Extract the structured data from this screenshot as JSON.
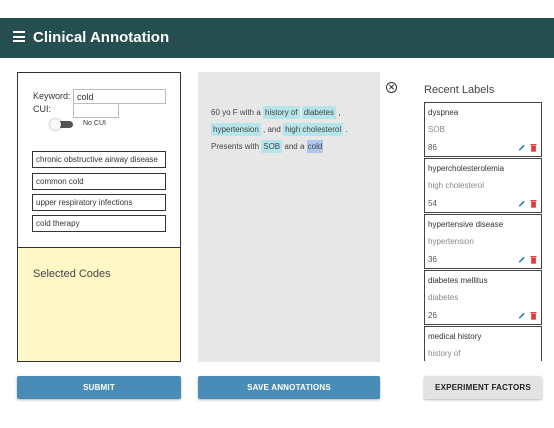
{
  "app": {
    "title": "Clinical Annotation"
  },
  "search": {
    "keyword_label": "Keyword:",
    "keyword_value": "cold",
    "cui_label": "CUI:",
    "cui_value": "",
    "no_cui_label": "No CUI",
    "no_cui_toggle_on": false
  },
  "concepts": [
    "chronic obstructive airway disease",
    "common cold",
    "upper respiratory infections",
    "cold therapy"
  ],
  "selected_codes": {
    "title": "Selected Codes"
  },
  "note": {
    "segments": [
      {
        "text": "60 yo F with a ",
        "highlight": "none"
      },
      {
        "text": "history of",
        "highlight": "label"
      },
      {
        "text": " ",
        "highlight": "none"
      },
      {
        "text": "diabetes",
        "highlight": "label"
      },
      {
        "text": " , ",
        "highlight": "none"
      },
      {
        "text": "hypertension",
        "highlight": "label"
      },
      {
        "text": " , and ",
        "highlight": "none"
      },
      {
        "text": "high cholesterol",
        "highlight": "label"
      },
      {
        "text": " . Presents with ",
        "highlight": "none"
      },
      {
        "text": "SOB",
        "highlight": "label"
      },
      {
        "text": " and a ",
        "highlight": "none"
      },
      {
        "text": "cold",
        "highlight": "selection"
      }
    ]
  },
  "recent_labels": {
    "title": "Recent Labels",
    "items": [
      {
        "name": "dyspnea",
        "text": "SOB",
        "count": "86"
      },
      {
        "name": "hypercholesterolemia",
        "text": "high cholesterol",
        "count": "54"
      },
      {
        "name": "hypertensive disease",
        "text": "hypertension",
        "count": "36"
      },
      {
        "name": "diabetes mellitus",
        "text": "diabetes",
        "count": "26"
      },
      {
        "name": "medical history",
        "text": "history of",
        "count": ""
      }
    ]
  },
  "buttons": {
    "submit": "SUBMIT",
    "save": "SAVE ANNOTATIONS",
    "experiment": "EXPERIMENT FACTORS"
  },
  "colors": {
    "header": "#264d4f",
    "primary_button": "#4a8cb8",
    "label_highlight": "#b5e4ea",
    "selection_highlight": "#aec7ef",
    "selected_codes_bg": "#fdf8c6",
    "edit_icon": "#2f7fae",
    "delete_icon": "#e53935"
  },
  "icons": {
    "menu": "menu-icon",
    "close": "close-circle-icon",
    "edit": "pencil-icon",
    "delete": "trash-icon"
  }
}
